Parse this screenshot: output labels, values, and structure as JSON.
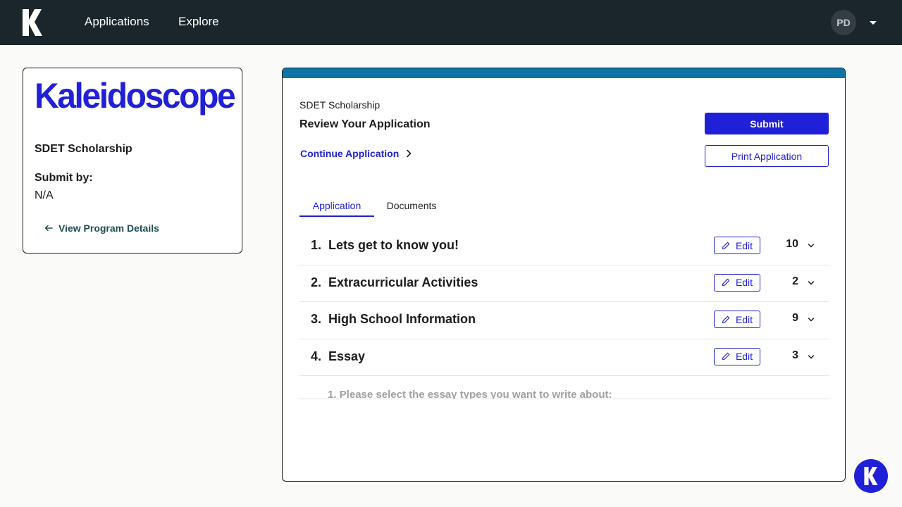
{
  "nav": {
    "logo_icon": "kaleidoscope-k-logo",
    "applications_label": "Applications",
    "explore_label": "Explore",
    "avatar_initials": "PD",
    "bg_color": "#1b262c"
  },
  "program_card": {
    "brand_name": "Kaleidoscope",
    "title": "SDET Scholarship",
    "submit_by_label": "Submit by:",
    "submit_by_value": "N/A",
    "details_link": "View Program Details"
  },
  "main": {
    "program_name": "SDET Scholarship",
    "heading": "Review Your Application",
    "continue_label": "Continue Application",
    "submit_label": "Submit",
    "print_label": "Print Application",
    "accent_color": "#2020d8",
    "topbar_color": "#0e74a5",
    "tabs": [
      {
        "label": "Application",
        "active": true
      },
      {
        "label": "Documents",
        "active": false
      }
    ],
    "sections": [
      {
        "title": "1.  Lets get to know you!",
        "edit_label": "Edit",
        "count": "10"
      },
      {
        "title": "2.  Extracurricular Activities",
        "edit_label": "Edit",
        "count": "2"
      },
      {
        "title": "3.  High School Information",
        "edit_label": "Edit",
        "count": "9"
      },
      {
        "title": "4.  Essay",
        "edit_label": "Edit",
        "count": "3"
      }
    ],
    "peek_question": "1. Please select the essay types you want to write about:"
  }
}
